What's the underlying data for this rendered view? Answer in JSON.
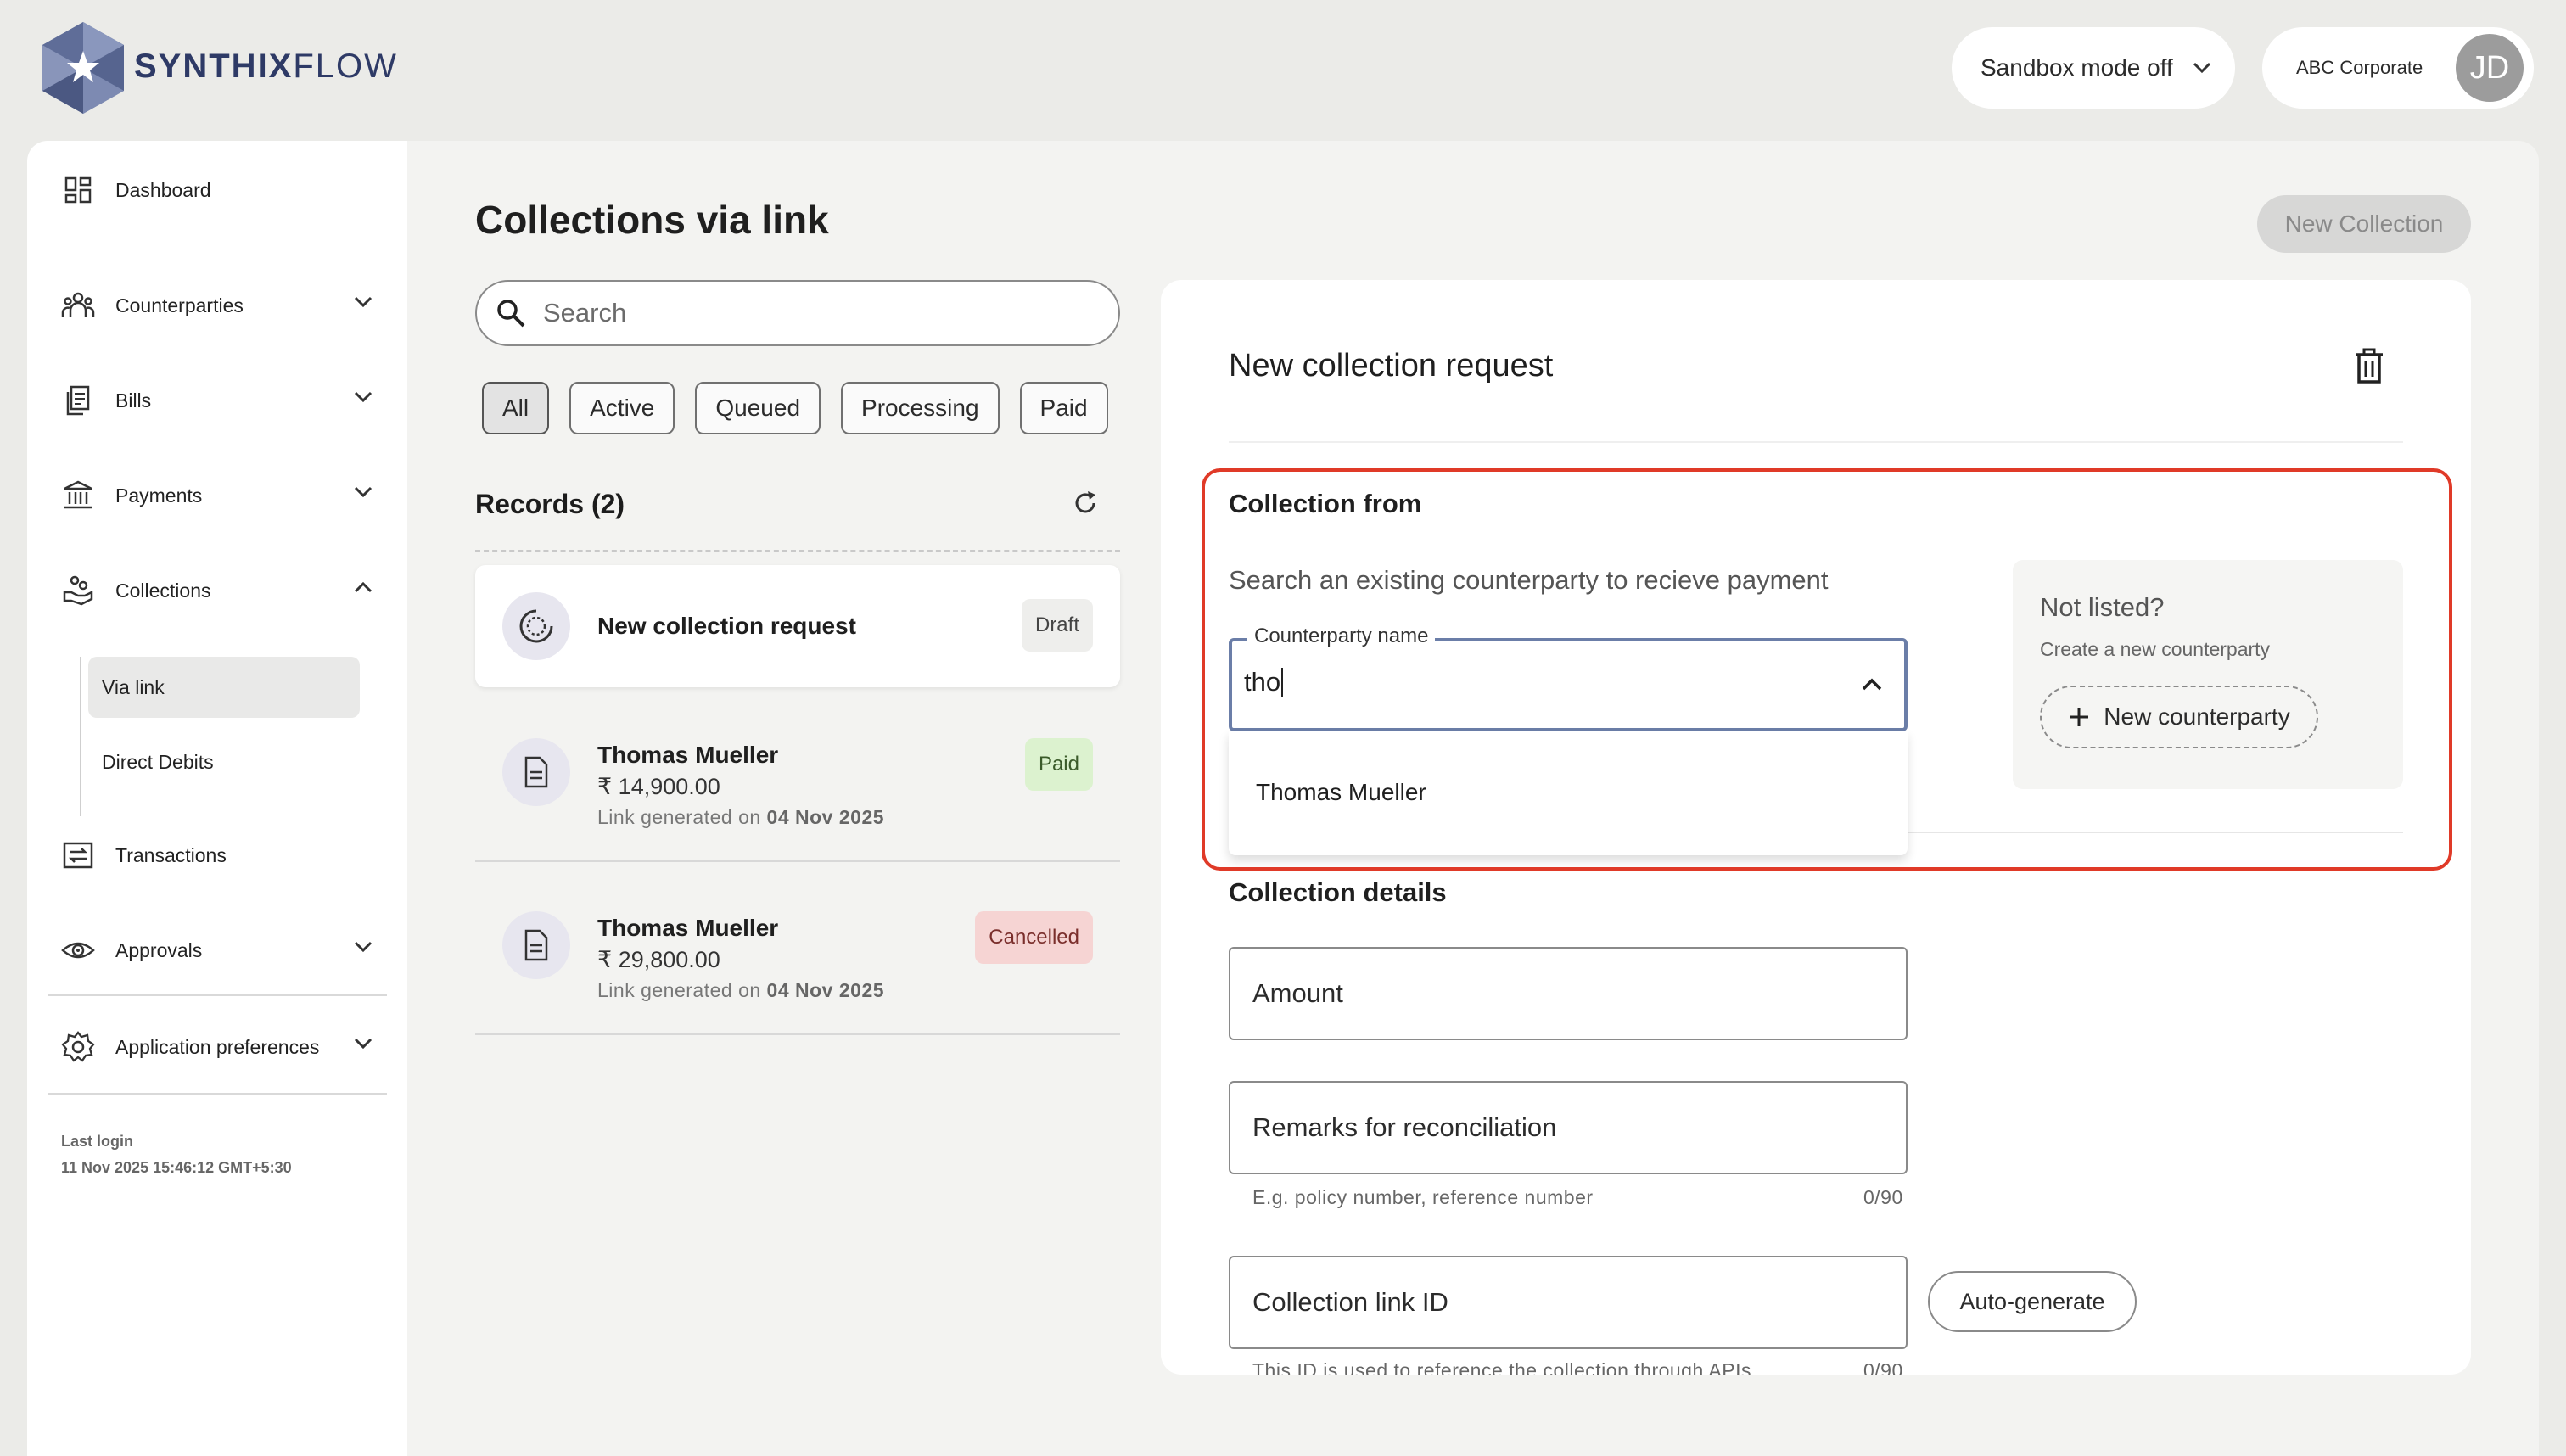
{
  "brand": {
    "name_bold": "SYNTHIX",
    "name_light": "FLOW",
    "logo_icon": "hexagon-star-logo"
  },
  "header": {
    "sandbox_label": "Sandbox mode off",
    "account_name": "ABC Corporate",
    "avatar_initials": "JD"
  },
  "sidebar": {
    "items": [
      {
        "label": "Dashboard",
        "icon": "grid-icon"
      },
      {
        "label": "Counterparties",
        "icon": "people-icon"
      },
      {
        "label": "Bills",
        "icon": "documents-icon"
      },
      {
        "label": "Payments",
        "icon": "bank-icon"
      },
      {
        "label": "Collections",
        "icon": "hand-coins-icon"
      },
      {
        "label": "Transactions",
        "icon": "exchange-icon"
      },
      {
        "label": "Approvals",
        "icon": "eye-icon"
      },
      {
        "label": "Application preferences",
        "icon": "gear-icon"
      }
    ],
    "collections_sub": [
      "Via link",
      "Direct Debits"
    ],
    "last_login_label": "Last login",
    "last_login_value": "11 Nov 2025 15:46:12 GMT+5:30"
  },
  "main": {
    "title": "Collections via link",
    "new_collection_label": "New Collection",
    "search_placeholder": "Search",
    "filters": [
      "All",
      "Active",
      "Queued",
      "Processing",
      "Paid"
    ],
    "records_title": "Records (2)",
    "records": [
      {
        "name": "New collection request",
        "status": "Draft"
      },
      {
        "name": "Thomas Mueller",
        "amount": "₹ 14,900.00",
        "generated_prefix": "Link generated on",
        "generated_date": "04 Nov 2025",
        "status": "Paid"
      },
      {
        "name": "Thomas Mueller",
        "amount": "₹ 29,800.00",
        "generated_prefix": "Link generated on",
        "generated_date": "04 Nov 2025",
        "status": "Cancelled"
      }
    ]
  },
  "form": {
    "title": "New collection request",
    "collection_from_title": "Collection from",
    "help_text": "Search an existing counterparty to recieve payment",
    "counterparty_label": "Counterparty name",
    "counterparty_value": "tho",
    "dropdown_options": [
      "Thomas Mueller"
    ],
    "not_listed_title": "Not listed?",
    "not_listed_sub": "Create a new counterparty",
    "new_counterparty_label": "New counterparty",
    "details_title": "Collection details",
    "amount_label": "Amount",
    "remarks_label": "Remarks for reconciliation",
    "remarks_hint": "E.g. policy number, reference number",
    "remarks_count": "0/90",
    "link_id_label": "Collection link ID",
    "autogen_label": "Auto-generate",
    "link_id_hint": "This ID is used to reference the collection through APIs",
    "link_id_count": "0/90"
  },
  "colors": {
    "accent_highlight": "#e03a28",
    "brand": "#2e3a66",
    "paid_bg": "#dcf2cf",
    "cancel_bg": "#f6d4d3"
  }
}
